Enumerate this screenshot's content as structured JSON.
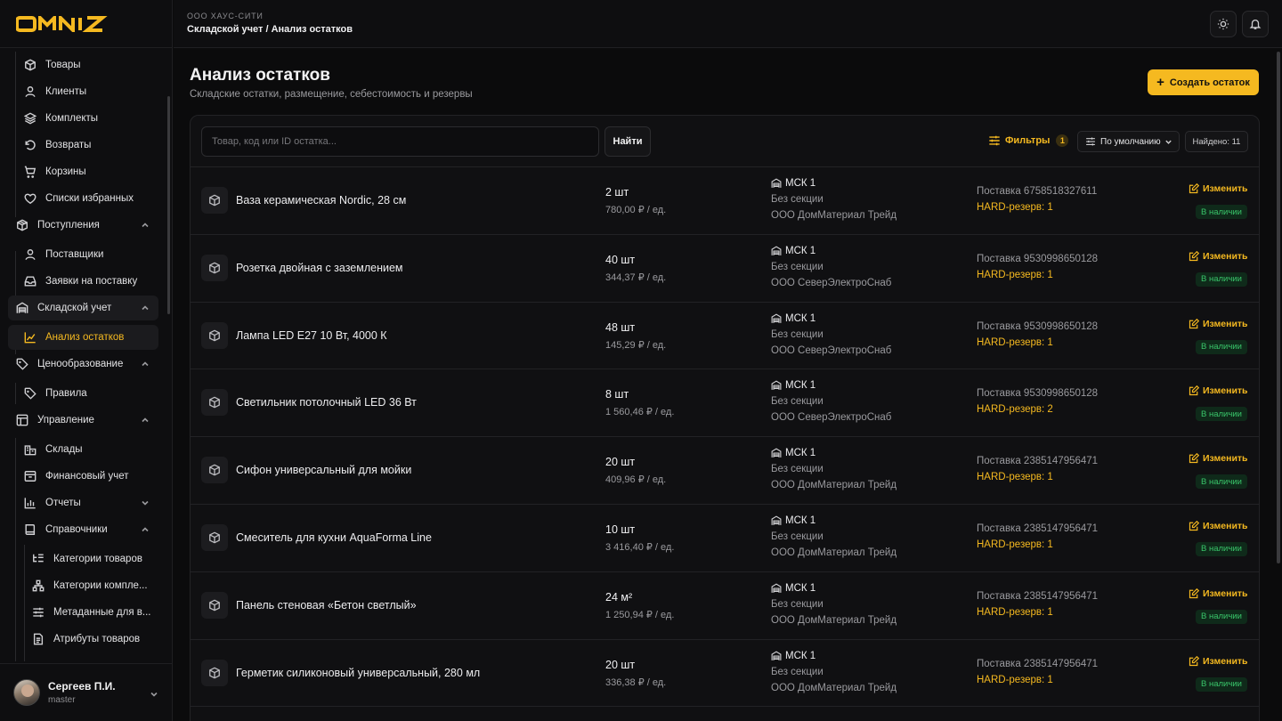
{
  "brand": {
    "logo_text": "OMNIZ",
    "accent": "#f5b920"
  },
  "header": {
    "org": "ООО ХАУС-СИТИ",
    "breadcrumb": "Складской учет / Анализ остатков",
    "buttons": [
      "sun-icon",
      "bell-icon"
    ]
  },
  "sidebar": {
    "items": [
      {
        "label": "Товары",
        "icon": "box-icon"
      },
      {
        "label": "Клиенты",
        "icon": "user-icon"
      },
      {
        "label": "Комплекты",
        "icon": "layers-icon"
      },
      {
        "label": "Возвраты",
        "icon": "return-icon"
      },
      {
        "label": "Корзины",
        "icon": "cart-icon"
      },
      {
        "label": "Списки избранных",
        "icon": "heart-icon"
      },
      {
        "label": "Поступления",
        "icon": "package-icon"
      },
      {
        "label": "Поставщики",
        "icon": "user-icon"
      },
      {
        "label": "Заявки на поставку",
        "icon": "inbox-icon"
      },
      {
        "label": "Складской учет",
        "icon": "warehouse-icon"
      },
      {
        "label": "Анализ остатков",
        "icon": "chart-icon"
      },
      {
        "label": "Ценообразование",
        "icon": "tag-icon"
      },
      {
        "label": "Правила",
        "icon": "tag-icon"
      },
      {
        "label": "Управление",
        "icon": "layout-icon"
      },
      {
        "label": "Склады",
        "icon": "building-icon"
      },
      {
        "label": "Финансовый учет",
        "icon": "archive-icon"
      },
      {
        "label": "Отчеты",
        "icon": "bar-chart-icon"
      },
      {
        "label": "Справочники",
        "icon": "book-icon"
      },
      {
        "label": "Категории товаров",
        "icon": "list-tree-icon"
      },
      {
        "label": "Категории компле...",
        "icon": "network-icon"
      },
      {
        "label": "Метаданные для в...",
        "icon": "sliders-icon"
      },
      {
        "label": "Атрибуты товаров",
        "icon": "file-icon"
      }
    ],
    "user": {
      "name": "Сергеев П.И.",
      "role": "master"
    }
  },
  "page": {
    "title": "Анализ остатков",
    "subtitle": "Складские остатки, размещение, себестоимость и резервы",
    "create_label": "Создать остаток"
  },
  "toolbar": {
    "search_placeholder": "Товар, код или ID остатка...",
    "search_value": "",
    "find_label": "Найти",
    "filters_label": "Фильтры",
    "filters_count": "1",
    "sort_label": "По умолчанию",
    "found_label": "Найдено: 11"
  },
  "rows": [
    {
      "name": "Ваза керамическая Nordic, 28 см",
      "qty": "2 шт",
      "price": "780,00 ₽ / ед.",
      "warehouse": "МСК 1",
      "section": "Без секции",
      "supplier": "ООО ДомМатериал Трейд",
      "delivery": "Поставка 6758518327611",
      "reserve": "HARD-резерв: 1",
      "edit": "Изменить",
      "status": "В наличии"
    },
    {
      "name": "Розетка двойная с заземлением",
      "qty": "40 шт",
      "price": "344,37 ₽ / ед.",
      "warehouse": "МСК 1",
      "section": "Без секции",
      "supplier": "ООО СеверЭлектроСнаб",
      "delivery": "Поставка 9530998650128",
      "reserve": "HARD-резерв: 1",
      "edit": "Изменить",
      "status": "В наличии"
    },
    {
      "name": "Лампа LED E27 10 Вт, 4000 К",
      "qty": "48 шт",
      "price": "145,29 ₽ / ед.",
      "warehouse": "МСК 1",
      "section": "Без секции",
      "supplier": "ООО СеверЭлектроСнаб",
      "delivery": "Поставка 9530998650128",
      "reserve": "HARD-резерв: 1",
      "edit": "Изменить",
      "status": "В наличии"
    },
    {
      "name": "Светильник потолочный LED 36 Вт",
      "qty": "8 шт",
      "price": "1 560,46 ₽ / ед.",
      "warehouse": "МСК 1",
      "section": "Без секции",
      "supplier": "ООО СеверЭлектроСнаб",
      "delivery": "Поставка 9530998650128",
      "reserve": "HARD-резерв: 2",
      "edit": "Изменить",
      "status": "В наличии"
    },
    {
      "name": "Сифон универсальный для мойки",
      "qty": "20 шт",
      "price": "409,96 ₽ / ед.",
      "warehouse": "МСК 1",
      "section": "Без секции",
      "supplier": "ООО ДомМатериал Трейд",
      "delivery": "Поставка 2385147956471",
      "reserve": "HARD-резерв: 1",
      "edit": "Изменить",
      "status": "В наличии"
    },
    {
      "name": "Смеситель для кухни AquaForma Line",
      "qty": "10 шт",
      "price": "3 416,40 ₽ / ед.",
      "warehouse": "МСК 1",
      "section": "Без секции",
      "supplier": "ООО ДомМатериал Трейд",
      "delivery": "Поставка 2385147956471",
      "reserve": "HARD-резерв: 1",
      "edit": "Изменить",
      "status": "В наличии"
    },
    {
      "name": "Панель стеновая «Бетон светлый»",
      "qty": "24 м²",
      "price": "1 250,94 ₽ / ед.",
      "warehouse": "МСК 1",
      "section": "Без секции",
      "supplier": "ООО ДомМатериал Трейд",
      "delivery": "Поставка 2385147956471",
      "reserve": "HARD-резерв: 1",
      "edit": "Изменить",
      "status": "В наличии"
    },
    {
      "name": "Герметик силиконовый универсальный, 280 мл",
      "qty": "20 шт",
      "price": "336,38 ₽ / ед.",
      "warehouse": "МСК 1",
      "section": "Без секции",
      "supplier": "ООО ДомМатериал Трейд",
      "delivery": "Поставка 2385147956471",
      "reserve": "HARD-резерв: 1",
      "edit": "Изменить",
      "status": "В наличии"
    }
  ]
}
